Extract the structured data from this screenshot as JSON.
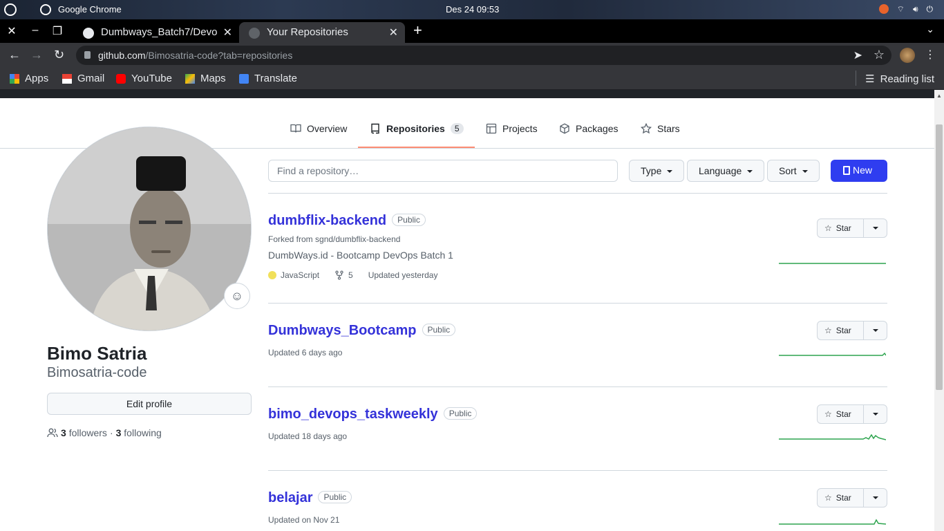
{
  "os": {
    "app_name": "Google Chrome",
    "clock": "Des 24  09:53",
    "tray": [
      "wifi",
      "volume",
      "power"
    ]
  },
  "tabs": [
    {
      "title": "Dumbways_Batch7/Devo",
      "active": false
    },
    {
      "title": "Your Repositories",
      "active": true
    }
  ],
  "address": {
    "domain": "github.com",
    "path": "/Bimosatria-code?tab=repositories"
  },
  "bookmarks": [
    {
      "label": "Apps",
      "icon": "apps-grid-icon"
    },
    {
      "label": "Gmail",
      "icon": "gmail-icon"
    },
    {
      "label": "YouTube",
      "icon": "youtube-icon"
    },
    {
      "label": "Maps",
      "icon": "maps-icon"
    },
    {
      "label": "Translate",
      "icon": "translate-icon"
    }
  ],
  "reading_list": "Reading list",
  "profile_nav": [
    {
      "label": "Overview",
      "icon": "book-icon"
    },
    {
      "label": "Repositories",
      "icon": "repo-icon",
      "count": "5",
      "active": true
    },
    {
      "label": "Projects",
      "icon": "table-icon"
    },
    {
      "label": "Packages",
      "icon": "package-icon"
    },
    {
      "label": "Stars",
      "icon": "star-icon"
    }
  ],
  "profile": {
    "name": "Bimo Satria",
    "username": "Bimosatria-code",
    "edit_label": "Edit profile",
    "followers_count": "3",
    "followers_label": "followers",
    "sep": "·",
    "following_count": "3",
    "following_label": "following"
  },
  "filters": {
    "search_placeholder": "Find a repository…",
    "type": "Type",
    "language": "Language",
    "sort": "Sort",
    "new": "New"
  },
  "repos": [
    {
      "name": "dumbflix-backend",
      "visibility": "Public",
      "forked_from": "Forked from sgnd/dumbflix-backend",
      "description": "DumbWays.id - Bootcamp DevOps Batch 1",
      "language": "JavaScript",
      "forks": "5",
      "updated": "Updated yesterday",
      "star_label": "Star"
    },
    {
      "name": "Dumbways_Bootcamp",
      "visibility": "Public",
      "updated": "Updated 6 days ago",
      "star_label": "Star"
    },
    {
      "name": "bimo_devops_taskweekly",
      "visibility": "Public",
      "updated": "Updated 18 days ago",
      "star_label": "Star"
    },
    {
      "name": "belajar",
      "visibility": "Public",
      "updated": "Updated on Nov 21",
      "star_label": "Star"
    }
  ],
  "colors": {
    "accent_link": "#3432d9",
    "new_button": "#2f3df0",
    "tab_underline": "#fd8c73",
    "sparkline": "#2da44e",
    "javascript": "#f1e05a"
  }
}
